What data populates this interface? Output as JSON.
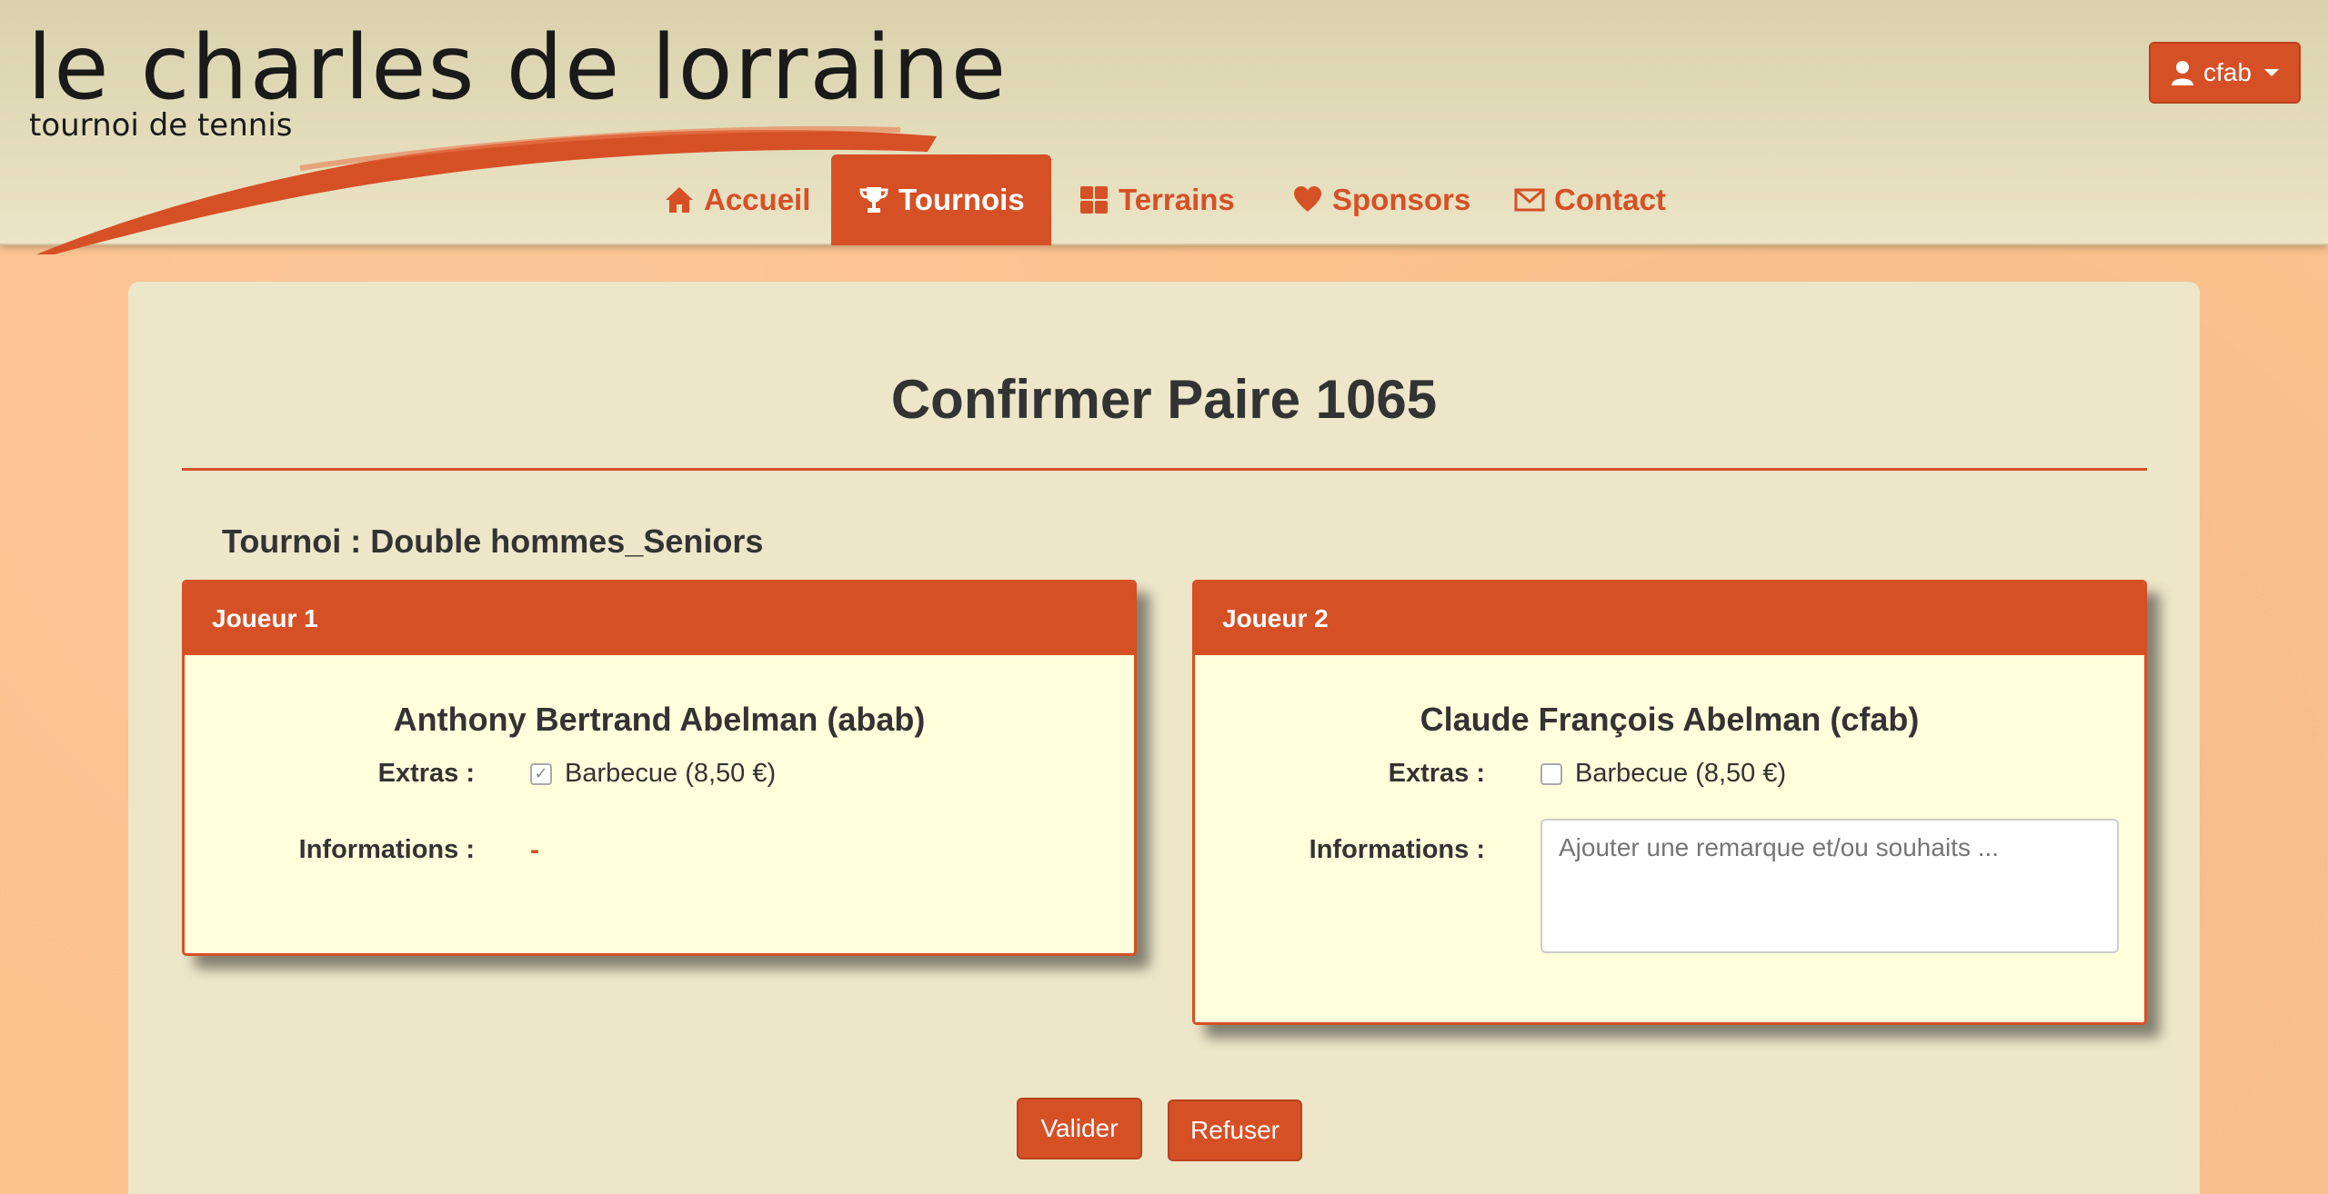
{
  "header": {
    "logo_title": "le charles de lorraine",
    "logo_subtitle": "tournoi de tennis",
    "user_label": "cfab",
    "nav": [
      {
        "label": "Accueil",
        "icon": "home-icon",
        "active": false
      },
      {
        "label": "Tournois",
        "icon": "trophy-icon",
        "active": true
      },
      {
        "label": "Terrains",
        "icon": "grid-icon",
        "active": false
      },
      {
        "label": "Sponsors",
        "icon": "heart-icon",
        "active": false
      },
      {
        "label": "Contact",
        "icon": "envelope-icon",
        "active": false
      }
    ]
  },
  "page": {
    "title": "Confirmer Paire 1065",
    "tournoi": "Tournoi : Double hommes_Seniors"
  },
  "players": [
    {
      "heading": "Joueur 1",
      "name": "Anthony Bertrand Abelman (abab)",
      "extras_label": "Extras :",
      "extra_option": "Barbecue (8,50 €)",
      "extra_checked": true,
      "info_label": "Informations :",
      "info_value": "-"
    },
    {
      "heading": "Joueur 2",
      "name": "Claude François Abelman (cfab)",
      "extras_label": "Extras :",
      "extra_option": "Barbecue (8,50 €)",
      "extra_checked": false,
      "info_label": "Informations :",
      "info_placeholder": "Ajouter une remarque et/ou souhaits ..."
    }
  ],
  "actions": {
    "validate": "Valider",
    "refuse": "Refuser"
  },
  "colors": {
    "accent": "#d65026",
    "header_bg": "#e4ddbd",
    "panel_bg": "#ede6c9",
    "card_bg": "#ffffdc",
    "page_bg": "#fbc28e"
  }
}
